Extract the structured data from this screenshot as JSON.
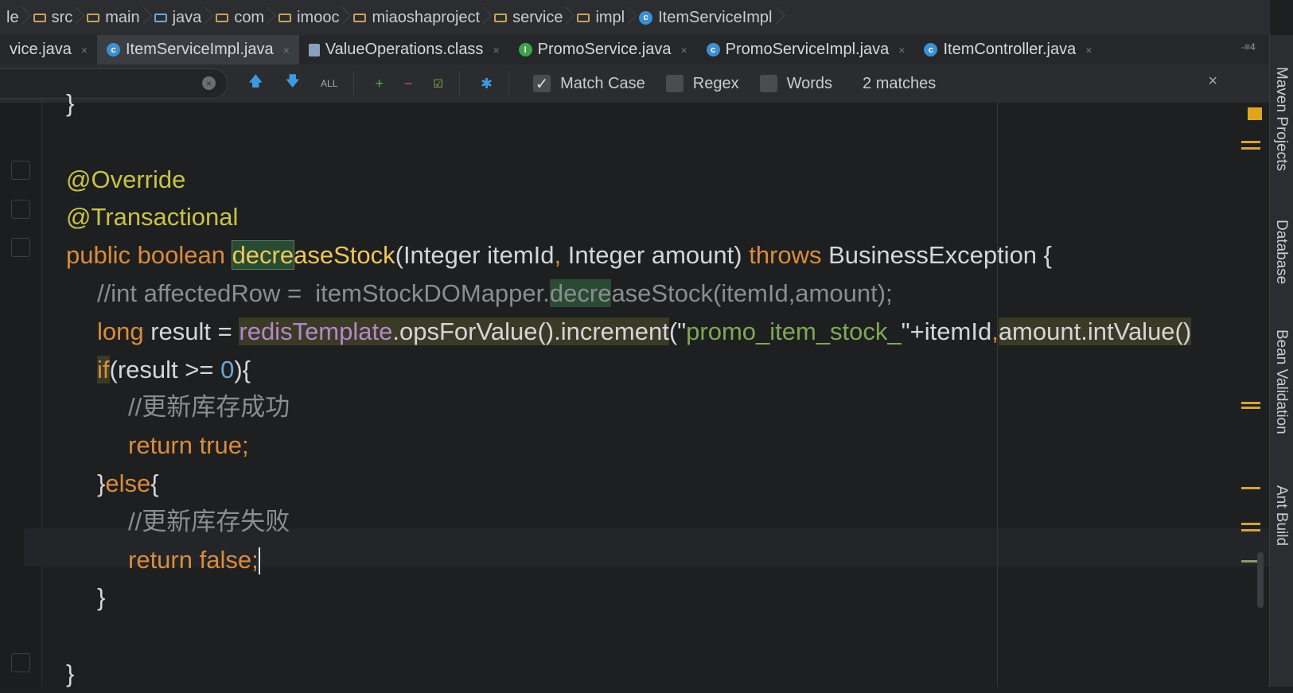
{
  "breadcrumb": [
    {
      "label": "le",
      "icon": "none"
    },
    {
      "label": "src",
      "icon": "folder-icon"
    },
    {
      "label": "main",
      "icon": "folder-icon"
    },
    {
      "label": "java",
      "icon": "source-folder-icon"
    },
    {
      "label": "com",
      "icon": "package-icon"
    },
    {
      "label": "imooc",
      "icon": "package-icon"
    },
    {
      "label": "miaoshaproject",
      "icon": "package-icon"
    },
    {
      "label": "service",
      "icon": "package-icon"
    },
    {
      "label": "impl",
      "icon": "package-icon"
    },
    {
      "label": "ItemServiceImpl",
      "icon": "class-icon"
    }
  ],
  "tabs": [
    {
      "label": "vice.java",
      "icon": "none",
      "active": false
    },
    {
      "label": "ItemServiceImpl.java",
      "icon": "class-icon",
      "active": true
    },
    {
      "label": "ValueOperations.class",
      "icon": "classfile-icon",
      "active": false
    },
    {
      "label": "PromoService.java",
      "icon": "interface-icon",
      "active": false
    },
    {
      "label": "PromoServiceImpl.java",
      "icon": "class-icon",
      "active": false
    },
    {
      "label": "ItemController.java",
      "icon": "class-icon",
      "active": false
    }
  ],
  "tab_overflow": "-≡4",
  "find": {
    "query": "",
    "match_case": {
      "label": "Match Case",
      "checked": true
    },
    "regex": {
      "label": "Regex",
      "checked": false
    },
    "words": {
      "label": "Words",
      "checked": false
    },
    "matches": "2 matches"
  },
  "code": [
    {
      "indent": 0,
      "tokens": [
        {
          "t": "}",
          "c": "pl"
        }
      ]
    },
    {
      "indent": 0,
      "tokens": []
    },
    {
      "indent": 0,
      "tokens": [
        {
          "t": "@Override",
          "c": "ann"
        }
      ]
    },
    {
      "indent": 0,
      "tokens": [
        {
          "t": "@Transactional",
          "c": "ann"
        }
      ]
    },
    {
      "indent": 0,
      "tokens": [
        {
          "t": "public boolean ",
          "c": "kw"
        },
        {
          "t": "decre",
          "c": "fn hlf"
        },
        {
          "t": "aseStock",
          "c": "fn"
        },
        {
          "t": "(Integer itemId",
          "c": "pl"
        },
        {
          "t": ", ",
          "c": "kw"
        },
        {
          "t": "Integer amount) ",
          "c": "pl"
        },
        {
          "t": "throws ",
          "c": "kw"
        },
        {
          "t": "BusinessException {",
          "c": "pl"
        }
      ]
    },
    {
      "indent": 1,
      "tokens": [
        {
          "t": "//int affectedRow =  itemStockDOMapper.",
          "c": "cm"
        },
        {
          "t": "decre",
          "c": "cm hlg"
        },
        {
          "t": "aseStock(itemId,amount);",
          "c": "cm"
        }
      ]
    },
    {
      "indent": 1,
      "tokens": [
        {
          "t": "long ",
          "c": "kw"
        },
        {
          "t": "result = ",
          "c": "pl"
        },
        {
          "t": "redisTemplate",
          "c": "fld hly"
        },
        {
          "t": ".opsForValue().increment",
          "c": "pl hly"
        },
        {
          "t": "(\"",
          "c": "pl"
        },
        {
          "t": "promo_item_stock_",
          "c": "str"
        },
        {
          "t": "\"+itemId",
          "c": "pl"
        },
        {
          "t": ",",
          "c": "kw"
        },
        {
          "t": "amount.intValue()",
          "c": "pl hly"
        }
      ]
    },
    {
      "indent": 1,
      "tokens": [
        {
          "t": "if",
          "c": "kw hli"
        },
        {
          "t": "(result >= ",
          "c": "pl"
        },
        {
          "t": "0",
          "c": "num"
        },
        {
          "t": "){",
          "c": "pl"
        }
      ]
    },
    {
      "indent": 2,
      "tokens": [
        {
          "t": "//更新库存成功",
          "c": "cm"
        }
      ]
    },
    {
      "indent": 2,
      "tokens": [
        {
          "t": "return true",
          "c": "kw"
        },
        {
          "t": ";",
          "c": "kw"
        }
      ]
    },
    {
      "indent": 1,
      "tokens": [
        {
          "t": "}",
          "c": "pl"
        },
        {
          "t": "else",
          "c": "kw"
        },
        {
          "t": "{",
          "c": "pl"
        }
      ]
    },
    {
      "indent": 2,
      "tokens": [
        {
          "t": "//更新库存失败",
          "c": "cm"
        }
      ]
    },
    {
      "indent": 2,
      "tokens": [
        {
          "t": "return false",
          "c": "kw"
        },
        {
          "t": ";",
          "c": "kw"
        }
      ],
      "caret": true
    },
    {
      "indent": 1,
      "tokens": [
        {
          "t": "}",
          "c": "pl"
        }
      ]
    },
    {
      "indent": 0,
      "tokens": []
    },
    {
      "indent": 0,
      "tokens": [
        {
          "t": "}",
          "c": "pl"
        }
      ]
    }
  ],
  "side_panels": [
    "Maven Projects",
    "Database",
    "Bean Validation",
    "Ant Build"
  ],
  "colors": {
    "keyword": "#d98c3c",
    "annotation": "#c8c24a",
    "method": "#f0c659",
    "string": "#7fa856",
    "field": "#b388c9",
    "comment": "#8a8d91",
    "number": "#6ea6d4",
    "background": "#1e1f20"
  }
}
